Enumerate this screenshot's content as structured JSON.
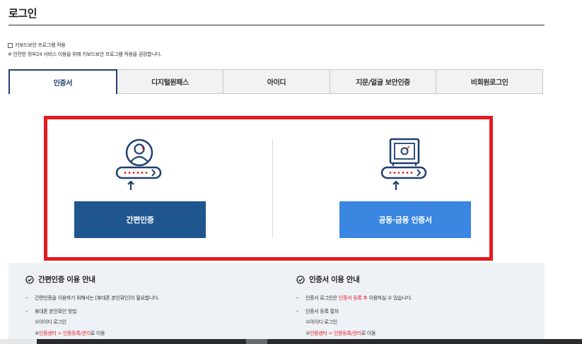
{
  "page": {
    "title": "로그인"
  },
  "keyboard": {
    "option_label": "키보드보안 프로그램 적용",
    "notice": "※ 안전한 정부24 서비스 이용을 위해 키보드보안 프로그램 적용을 권장합니다."
  },
  "tabs": [
    {
      "label": "인증서",
      "active": true
    },
    {
      "label": "디지털원패스",
      "active": false
    },
    {
      "label": "아이디",
      "active": false
    },
    {
      "label": "지문/얼굴 보안인증",
      "active": false
    },
    {
      "label": "비회원로그인",
      "active": false
    }
  ],
  "options": {
    "simple_auth_button": "간편인증",
    "cert_button": "공동·금융 인증서"
  },
  "guide": {
    "left": {
      "title": "간편인증 이용 안내",
      "line1": "간편인증을 이용하기 위해서는 [휴대폰 본인확인]이 필요합니다.",
      "line2": "휴대폰 본인확인 방법",
      "step1": "①아이디 로그인",
      "step2_prefix": "②",
      "step2_red": "인증센터 > 인증등록/관리",
      "step2_suffix": "로 이동"
    },
    "right": {
      "title": "인증서 이용 안내",
      "line1_prefix": "인증서 로그인은 ",
      "line1_red": "인증서 등록 후",
      "line1_suffix": " 이용하실 수 있습니다.",
      "line2": "인증서 등록 절차",
      "step1": "①아이디 로그인",
      "step2_prefix": "②",
      "step2_red": "인증센터 > 인증등록/관리",
      "step2_suffix": "로 이동"
    }
  },
  "colors": {
    "navy": "#1f3f6e",
    "simple_btn": "#1f568f",
    "cert_btn": "#3a86e0",
    "highlight": "#e31b23"
  }
}
